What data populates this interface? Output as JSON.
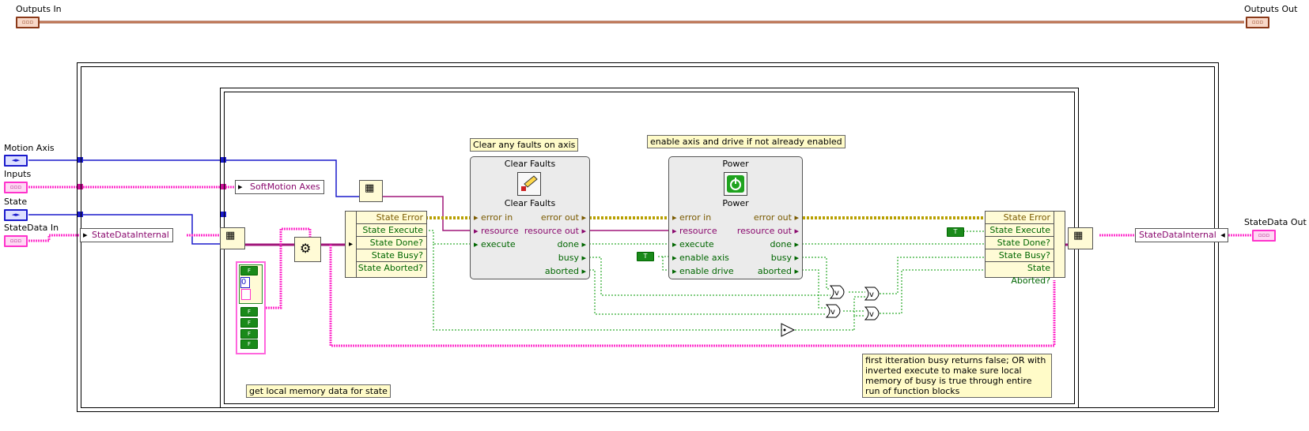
{
  "controls": {
    "outputs_in": "Outputs In",
    "outputs_out": "Outputs Out",
    "motion_axis": "Motion Axis",
    "inputs": "Inputs",
    "state": "State",
    "statedata_in": "StateData In",
    "statedata_out": "StateData Out"
  },
  "terminal_glyphs": {
    "cluster": "▫▫▫",
    "refnum": "◄►",
    "bool_true": "T",
    "bool_false": "F",
    "numeric_zero": "0"
  },
  "tags": {
    "softmotion_axes": "SoftMotion Axes",
    "statedatainternal_left": "StateDataInternal",
    "statedatainternal_right": "StateDataInternal"
  },
  "unbundle": {
    "rows": [
      "State Error",
      "State Execute",
      "State Done?",
      "State Busy?",
      "State Aborted?"
    ]
  },
  "bundle": {
    "rows": [
      "State Error",
      "State Execute",
      "State Done?",
      "State Busy?",
      "State Aborted?"
    ]
  },
  "clear_faults": {
    "title": "Clear Faults",
    "subtitle": "Clear Faults",
    "inputs": [
      "error in",
      "resource",
      "execute"
    ],
    "outputs": [
      "error out",
      "resource out",
      "done",
      "busy",
      "aborted"
    ]
  },
  "power": {
    "title": "Power",
    "subtitle": "Power",
    "inputs": [
      "error in",
      "resource",
      "execute",
      "enable axis",
      "enable drive"
    ],
    "outputs": [
      "error out",
      "resource out",
      "done",
      "busy",
      "aborted"
    ]
  },
  "comments": {
    "clear_faults": "Clear any faults on axis",
    "power": "enable axis and drive if not already enabled",
    "local_memory": "get local memory data for state",
    "first_iteration": "first itteration busy returns false; OR with inverted execute to make sure local memory of busy is true through entire run of function blocks"
  },
  "colors": {
    "refnum_wire": "#1a1acc",
    "cluster_wire": "#ff33cc",
    "error_wire": "#b8a000",
    "bool_wire": "#009900",
    "block_bg": "#ebebeb",
    "note_bg": "#fffbc8"
  }
}
